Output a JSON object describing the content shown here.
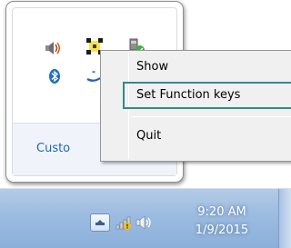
{
  "overflow_flyout": {
    "customize_link": "Custo",
    "icons": [
      "speaker-icon",
      "grip-handle-icon",
      "usb-device-icon",
      "bluetooth-icon",
      "blue-app-icon"
    ]
  },
  "context_menu": {
    "items": [
      {
        "label": "Show"
      },
      {
        "label": "Set Function keys"
      },
      {
        "label": "Quit"
      }
    ],
    "highlighted_index": 1
  },
  "taskbar": {
    "clock": {
      "time": "9:20 AM",
      "date": "1/9/2015"
    },
    "tray_icons": [
      "show-hidden-icons-button",
      "network-icon",
      "volume-icon"
    ]
  },
  "colors": {
    "taskbar": "#9cbbe0",
    "link": "#1a68b8",
    "menu_focus": "#2f8a8a",
    "menu_bg": "#f0f0f0"
  }
}
